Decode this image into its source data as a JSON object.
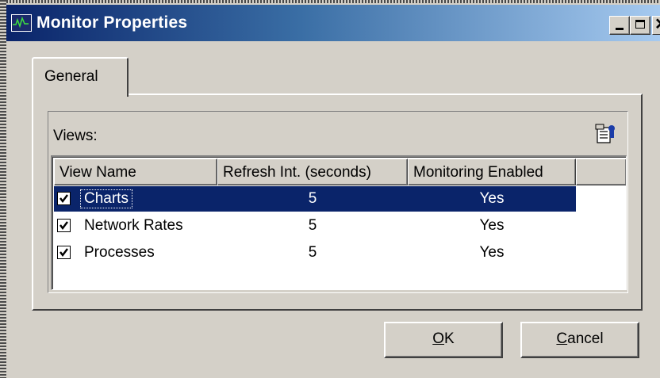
{
  "window": {
    "title": "Monitor Properties",
    "app_icon": "monitor-chart-icon",
    "controls": {
      "minimize_icon": "minimize-icon",
      "maximize_icon": "maximize-icon",
      "close_icon": "close-icon"
    }
  },
  "tabs": [
    {
      "label": "General",
      "active": true
    }
  ],
  "views_section": {
    "label": "Views:",
    "properties_icon": "properties-icon",
    "columns": [
      "View Name",
      "Refresh Int. (seconds)",
      "Monitoring Enabled",
      ""
    ],
    "rows": [
      {
        "name": "Charts",
        "refresh": "5",
        "monitoring": "Yes",
        "checked": true,
        "selected": true
      },
      {
        "name": "Network Rates",
        "refresh": "5",
        "monitoring": "Yes",
        "checked": true,
        "selected": false
      },
      {
        "name": "Processes",
        "refresh": "5",
        "monitoring": "Yes",
        "checked": true,
        "selected": false
      }
    ]
  },
  "buttons": {
    "ok_prefix": "O",
    "ok_rest": "K",
    "cancel_prefix": "C",
    "cancel_rest": "ancel"
  },
  "colors": {
    "titlebar_start": "#0a246a",
    "titlebar_end": "#a6caf0",
    "selection": "#0a246a",
    "face": "#d4d0c8"
  }
}
